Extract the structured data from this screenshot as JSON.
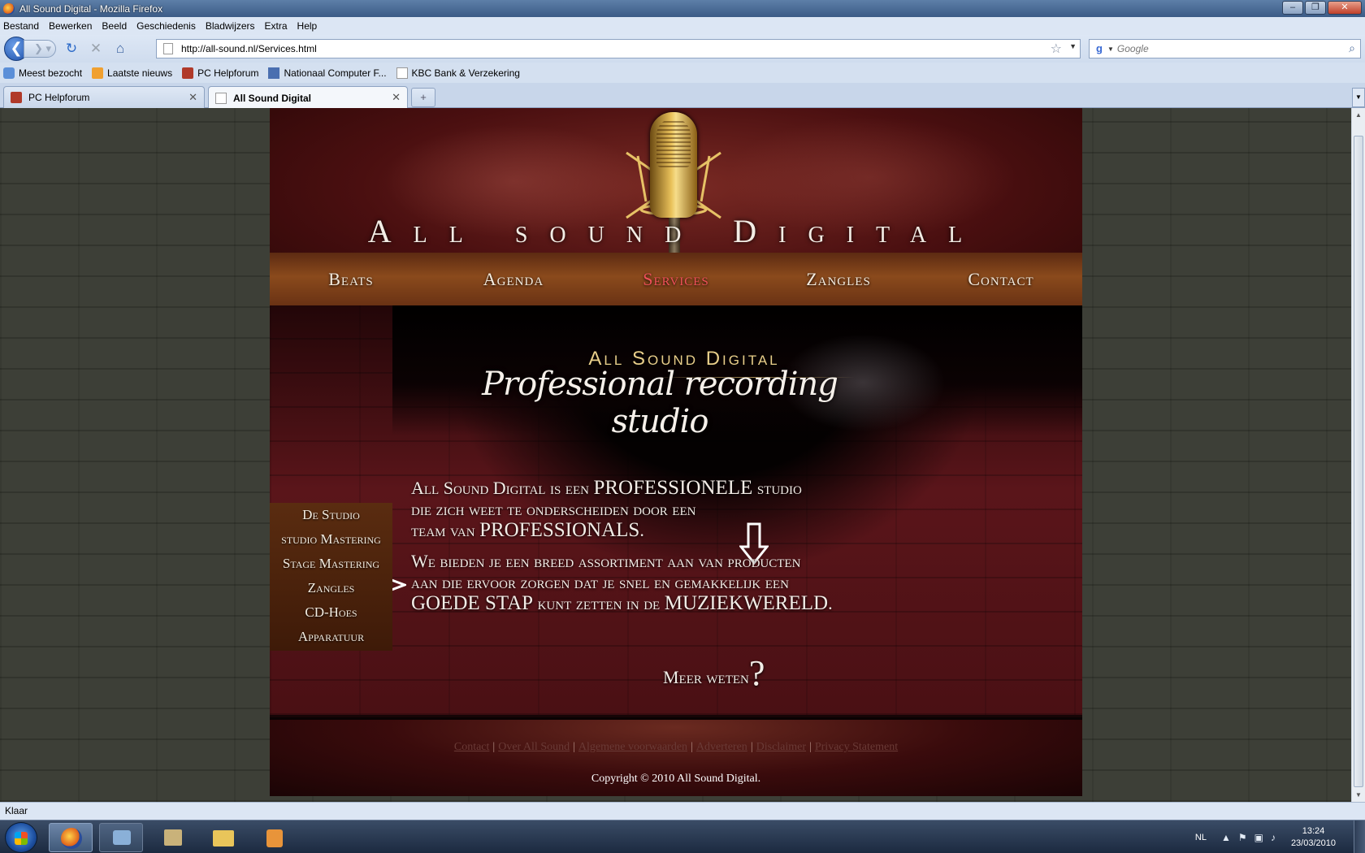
{
  "window": {
    "title": "All Sound Digital - Mozilla Firefox",
    "controls": [
      "–",
      "❐",
      "✕"
    ]
  },
  "menu": [
    "Bestand",
    "Bewerken",
    "Beeld",
    "Geschiedenis",
    "Bladwijzers",
    "Extra",
    "Help"
  ],
  "nav": {
    "url": "http://all-sound.nl/Services.html",
    "search_placeholder": "Google"
  },
  "bookmarks": [
    "Meest bezocht",
    "Laatste nieuws",
    "PC Helpforum",
    "Nationaal Computer F...",
    "KBC Bank & Verzekering"
  ],
  "tabs": [
    {
      "label": "PC Helpforum",
      "active": false
    },
    {
      "label": "All Sound Digital",
      "active": true
    }
  ],
  "site": {
    "title": "All sound Digital",
    "nav": [
      "Beats",
      "Agenda",
      "Services",
      "Zangles",
      "Contact"
    ],
    "active_nav": "Services",
    "active_color": "#f0505a",
    "sidebar": [
      "De Studio",
      "studio Mastering",
      "Stage Mastering",
      "Zangles",
      "CD-Hoes",
      "Apparatuur"
    ],
    "logo": {
      "top": "All Sound Digital",
      "script": "Professional recording studio"
    },
    "para1": {
      "a": "All Sound Digital is een",
      "b": "PROFESSIONELE",
      "c": "studio",
      "d": "die zich weet te onderscheiden door een",
      "e": "team van",
      "f": "PROFESSIONALS",
      "g": "."
    },
    "para2": {
      "a": "We bieden je een breed assortiment aan van producten",
      "b": "aan die ervoor zorgen dat je snel en gemakkelijk een",
      "c": "GOEDE STAP",
      "d": "kunt zetten in de",
      "e": "MUZIEKWERELD",
      "f": "."
    },
    "meer": {
      "text": "Meer weten",
      "q": "?"
    },
    "footer": {
      "links": [
        "Contact",
        "Over All Sound",
        "Algemene voorwaarden",
        "Adverteren",
        "Disclaimer",
        "Privacy Statement"
      ],
      "separator": "|",
      "copyright": "Copyright © 2010 All Sound Digital."
    }
  },
  "status": "Klaar",
  "taskbar": {
    "lang": "NL",
    "time": "13:24",
    "date": "23/03/2010"
  }
}
